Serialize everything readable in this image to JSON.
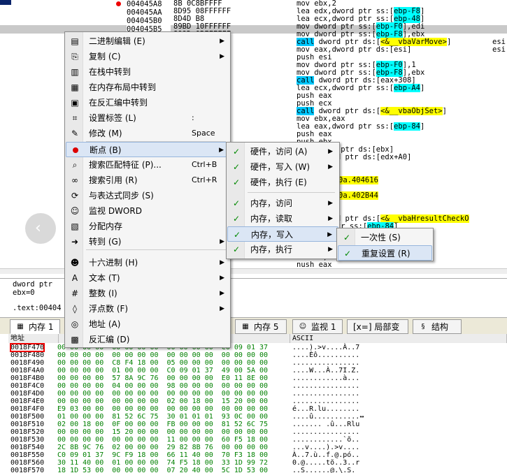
{
  "cpu": {
    "addresses": [
      "004045A8",
      "004045AA",
      "004045B0",
      "004045B5",
      "004045B9"
    ],
    "hex_rows": [
      "8B 0C8BFFFF",
      "8D95 08FFFFFF",
      "8D4D B8",
      "89BD 10FFFFFF",
      "899D 0BFFFFFF",
      "104000",
      "",
      "",
      "FFFFF 0100000",
      "FFFFF",
      "030000",
      "",
      "",
      "",
      "",
      "104000",
      "",
      "",
      "",
      "",
      "",
      "",
      "",
      "",
      "",
      "",
      "",
      "",
      "",
      "",
      "",
      "",
      "",
      "FFFFF",
      "FFFFF"
    ],
    "disasm": [
      {
        "pre": "mov ebx,2",
        "after": ""
      },
      {
        "pre": "lea edx,dword ptr ss:[",
        "ebp": "ebp-F8",
        "post": "]"
      },
      {
        "pre": "lea ecx,dword ptr ss:[",
        "ebp": "ebp-48",
        "post": "]"
      },
      {
        "pre": "mov dword ptr ss:[",
        "ebp": "ebp-F0",
        "post": "],edi"
      },
      {
        "pre": "mov dword ptr ss:[",
        "ebp": "ebp-F8",
        "post": "],ebx"
      },
      {
        "call": "call",
        "pre": " dword ptr ds:[",
        "sym": "<&__vbaVarMove>",
        "post": "]"
      },
      {
        "pre": "mov eax,dword ptr ds:[esi]"
      },
      {
        "pre": "push esi"
      },
      {
        "pre": "mov dword ptr ss:[",
        "ebp": "ebp-F0",
        "post": "],1"
      },
      {
        "pre": "mov dword ptr ss:[",
        "ebp": "ebp-F8",
        "post": "],ebx"
      },
      {
        "call": "call",
        "pre": " dword ptr ds:[eax+308]"
      },
      {
        "pre": "lea ecx,dword ptr ss:[",
        "ebp": "ebp-A4",
        "post": "]"
      },
      {
        "pre": "push eax"
      },
      {
        "pre": "push ecx"
      },
      {
        "call": "call",
        "pre": " dword ptr ds:[",
        "sym": "<&__vbaObjSet>",
        "post": "]"
      },
      {
        "pre": "mov ebx,eax"
      },
      {
        "pre": "lea eax,dword ptr ss:[",
        "ebp": "ebp-84",
        "post": "]"
      },
      {
        "pre": "push eax"
      },
      {
        "pre": "push ebx"
      },
      {
        "pre": "mov dword ptr ds:[ebx]"
      },
      {
        "pre": "call dword ptr ds:[edx+A0]"
      },
      {
        "pre": "di"
      },
      {
        "pre": ""
      },
      {
        "yel": "0a.404616"
      },
      {
        "pre": ""
      },
      {
        "yel": "0a.402B44"
      },
      {
        "pre": ""
      },
      {
        "pre": ""
      },
      {
        "call": "call",
        "pre": " dword ptr ds:[",
        "sym": "<&__vbaHresultCheckO",
        "post": ""
      },
      {
        "pre": "d dword ptr ss:[",
        "ebp": "ebp-84",
        "post": "]"
      },
      {
        "pre": ""
      },
      {
        "sym": "nBstr>",
        "post": "]"
      },
      {
        "pre": "ax"
      },
      {
        "pre": "ea eax,dword ptr ss:[",
        "ebp": "ebp-1C8",
        "post": "]"
      },
      {
        "pre": "nush eax"
      }
    ],
    "comments": [
      "esi",
      "esi"
    ],
    "info": [
      "dword ptr",
      "ebx=0",
      "",
      ".text:00404"
    ]
  },
  "context_menu": {
    "items": [
      {
        "icon": "binary-edit-icon",
        "label": "二进制编辑 (E)",
        "arrow": true
      },
      {
        "icon": "copy-icon",
        "label": "复制 (C)",
        "arrow": true
      },
      {
        "icon": "stack-icon",
        "label": "在栈中转到",
        "arrow": false
      },
      {
        "icon": "memory-layout-icon",
        "label": "在内存布局中转到",
        "arrow": false
      },
      {
        "icon": "disassembly-icon",
        "label": "在反汇编中转到",
        "arrow": false
      },
      {
        "icon": "label-icon",
        "label": "设置标签 (L)",
        "shortcut": ":",
        "arrow": false
      },
      {
        "icon": "pencil-icon",
        "label": "修改 (M)",
        "shortcut": "Space",
        "arrow": false
      },
      {
        "icon": "breakpoint-icon",
        "label": "断点 (B)",
        "arrow": true,
        "hot": true
      },
      {
        "icon": "search-pattern-icon",
        "label": "搜索匹配特征 (P)...",
        "shortcut": "Ctrl+B",
        "arrow": false
      },
      {
        "icon": "binoculars-icon",
        "label": "搜索引用 (R)",
        "shortcut": "Ctrl+R",
        "arrow": false
      },
      {
        "icon": "sync-icon",
        "label": "与表达式同步 (S)",
        "arrow": false
      },
      {
        "icon": "watch-icon",
        "label": "监视 DWORD",
        "arrow": false
      },
      {
        "icon": "allocate-icon",
        "label": "分配内存",
        "arrow": false
      },
      {
        "icon": "goto-icon",
        "label": "转到 (G)",
        "arrow": true
      },
      {
        "icon": "hex-face-icon",
        "label": "十六进制 (H)",
        "arrow": true
      },
      {
        "icon": "text-icon",
        "label": "文本 (T)",
        "arrow": true
      },
      {
        "icon": "integer-icon",
        "label": "整数 (I)",
        "arrow": true
      },
      {
        "icon": "float-icon",
        "label": "浮点数 (F)",
        "arrow": true
      },
      {
        "icon": "address-icon",
        "label": "地址 (A)",
        "arrow": false
      },
      {
        "icon": "disasm-view-icon",
        "label": "反汇编 (D)",
        "arrow": false
      }
    ]
  },
  "breakpoint_submenu": {
    "items": [
      {
        "label": "硬件，访问 (A)",
        "arrow": true
      },
      {
        "label": "硬件，写入 (W)",
        "arrow": true
      },
      {
        "label": "硬件，执行 (E)",
        "arrow": false
      },
      {
        "label": "内存，访问",
        "arrow": true
      },
      {
        "label": "内存，读取",
        "arrow": true
      },
      {
        "label": "内存，写入",
        "arrow": true,
        "hot": true
      },
      {
        "label": "内存，执行",
        "arrow": true
      }
    ]
  },
  "memory_write_submenu": {
    "items": [
      {
        "label": "一次性 (S)"
      },
      {
        "label": "重复设置 (R)",
        "hot": true
      }
    ]
  },
  "tabs": [
    {
      "icon": "memory-icon",
      "label": "内存 1",
      "active": true
    },
    {
      "icon": "memory-icon",
      "label": "内存 5"
    },
    {
      "icon": "watch-icon",
      "label": "监视 1"
    },
    {
      "icon": "locals-icon",
      "label": "[x=] 局部变量"
    },
    {
      "icon": "struct-icon",
      "label": "结构体"
    }
  ],
  "dump": {
    "header": {
      "address": "地址",
      "hex": "",
      "ascii": "ASCII"
    },
    "rows": [
      {
        "addr": "0018F470",
        "hex": "00 00 00 00  00 00 00 00  00 00 00 00  C0 09 01 37",
        "ascii": "....).>v....À..7"
      },
      {
        "addr": "0018F480",
        "hex": "00 00 00 00  00 00 00 00  00 00 00 00  00 00 00 00",
        "ascii": "....Èô.........."
      },
      {
        "addr": "0018F490",
        "hex": "00 00 00 00  C8 F4 18 00  05 00 00 00  00 00 00 00",
        "ascii": "................"
      },
      {
        "addr": "0018F4A0",
        "hex": "00 00 00 00  01 00 00 00  C0 09 01 37  49 00 5A 00",
        "ascii": "....W...À..7I.Z."
      },
      {
        "addr": "0018F4B0",
        "hex": "00 00 00 00  57 8A 9C 76  00 00 00 00  E0 11 8E 00",
        "ascii": "............à..."
      },
      {
        "addr": "0018F4C0",
        "hex": "00 00 00 00  04 00 00 00  98 00 00 00  00 00 00 00",
        "ascii": "................"
      },
      {
        "addr": "0018F4D0",
        "hex": "00 00 00 00  00 00 00 00  00 00 00 00  00 00 00 00",
        "ascii": "................"
      },
      {
        "addr": "0018F4E0",
        "hex": "00 00 00 00  00 00 00 00  02 00 18 00  15 20 00 00",
        "ascii": "................"
      },
      {
        "addr": "0018F4F0",
        "hex": "E9 03 00 00  00 00 00 00  00 00 00 00  00 00 00 00",
        "ascii": "é...R.lu........"
      },
      {
        "addr": "0018F500",
        "hex": "01 00 00 00  81 52 6C 75  30 01 01 01  93 0C 00 00",
        "ascii": "....û...........↔"
      },
      {
        "addr": "0018F510",
        "hex": "02 00 18 00  0F 00 00 00  FB 00 00 00  81 52 6C 75",
        "ascii": "....... .û...Rlu"
      },
      {
        "addr": "0018F520",
        "hex": "00 00 00 00  15 20 00 00  00 00 00 00  00 00 00 00",
        "ascii": "................"
      },
      {
        "addr": "0018F530",
        "hex": "00 00 00 00  00 00 00 00  11 00 00 00  60 F5 18 00",
        "ascii": "............`õ.."
      },
      {
        "addr": "0018F540",
        "hex": "2C 8B 9C 76  02 00 00 00  29 82 8B 76  00 00 00 00",
        "ascii": "...v....).>v...."
      },
      {
        "addr": "0018F550",
        "hex": "C0 09 01 37  9C F9 18 00  66 11 40 00  70 F3 18 00",
        "ascii": "À..7.ù..f.@.pó.."
      },
      {
        "addr": "0018F560",
        "hex": "30 11 40 00  01 00 00 00  74 F5 18 00  33 1D 99 72",
        "ascii": "0.@.....tõ..3..r"
      },
      {
        "addr": "0018F570",
        "hex": "18 1D 53 00  00 00 00 00  07 20 40 00  5C 1D 53 00",
        "ascii": "..S......@.\\.S."
      }
    ]
  }
}
